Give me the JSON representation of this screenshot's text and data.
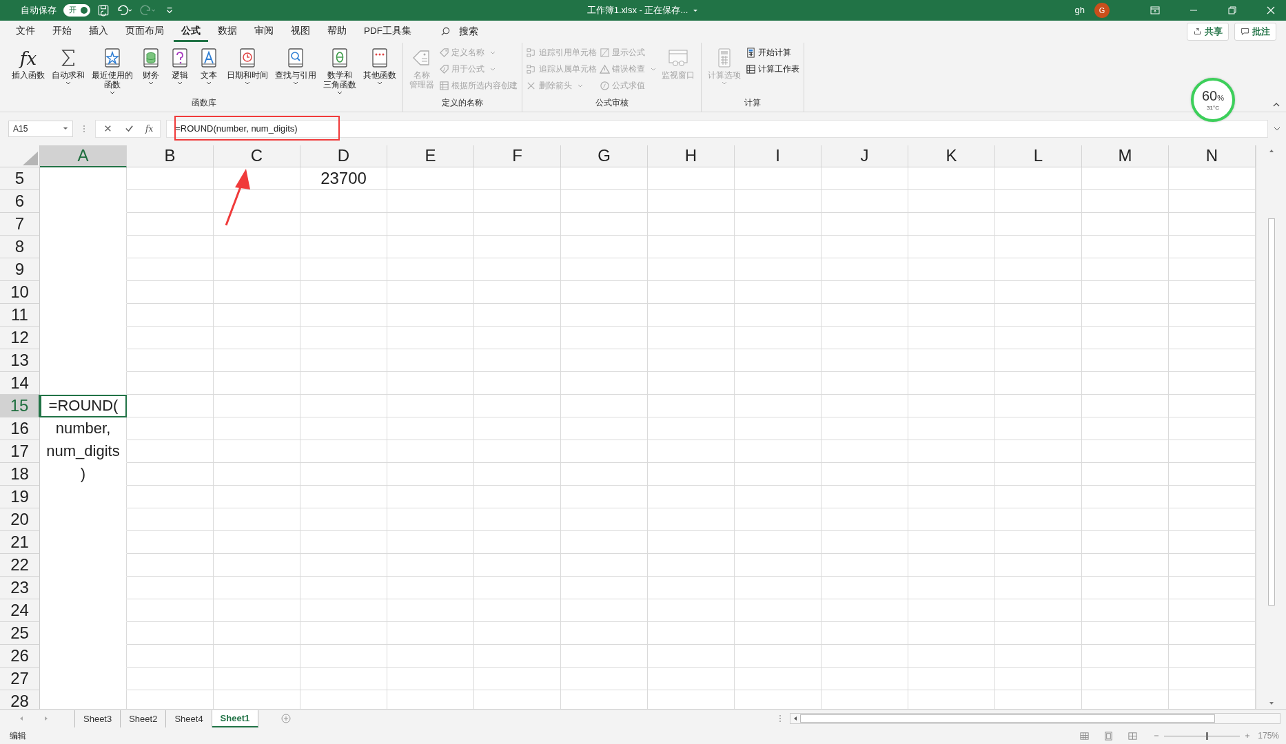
{
  "title_bar": {
    "autosave_label": "自动保存",
    "autosave_on": true,
    "autosave_state": "开",
    "title": "工作簿1.xlsx  -  正在保存...",
    "user": "gh",
    "avatar": "G"
  },
  "ribbon_tabs": [
    {
      "label": "文件",
      "selected": false
    },
    {
      "label": "开始",
      "selected": false
    },
    {
      "label": "插入",
      "selected": false
    },
    {
      "label": "页面布局",
      "selected": false
    },
    {
      "label": "公式",
      "selected": true
    },
    {
      "label": "数据",
      "selected": false
    },
    {
      "label": "审阅",
      "selected": false
    },
    {
      "label": "视图",
      "selected": false
    },
    {
      "label": "帮助",
      "selected": false
    },
    {
      "label": "PDF工具集",
      "selected": false
    }
  ],
  "search": {
    "label": "搜索"
  },
  "share_button": "共享",
  "comments_button": "批注",
  "ribbon_groups": [
    {
      "label": "函数库",
      "items": [
        {
          "kind": "large",
          "glyph": "fx",
          "label": "插入函数",
          "dropdown": false,
          "disabled": false
        },
        {
          "kind": "large",
          "label": "自动求和",
          "dropdown": true,
          "disabled": false
        },
        {
          "kind": "large",
          "label": "最近使用的函数",
          "dropdown": true,
          "disabled": false
        },
        {
          "kind": "large",
          "label": "财务",
          "dropdown": true,
          "disabled": false
        },
        {
          "kind": "large",
          "label": "逻辑",
          "dropdown": true,
          "disabled": false
        },
        {
          "kind": "large",
          "label": "文本",
          "dropdown": true,
          "disabled": false
        },
        {
          "kind": "large",
          "label": "日期和时间",
          "dropdown": true,
          "disabled": false
        },
        {
          "kind": "large",
          "label": "查找与引用",
          "dropdown": true,
          "disabled": false
        },
        {
          "kind": "large",
          "label": "数学和三角函数",
          "dropdown": true,
          "disabled": false
        },
        {
          "kind": "large",
          "label": "其他函数",
          "dropdown": true,
          "disabled": false
        }
      ]
    },
    {
      "label": "定义的名称",
      "items": [
        {
          "kind": "large",
          "label": "名称管理器",
          "dropdown": false,
          "disabled": true
        },
        {
          "kind": "stack",
          "entries": [
            {
              "label": "定义名称",
              "dropdown": true,
              "disabled": true
            },
            {
              "label": "用于公式",
              "dropdown": true,
              "disabled": true
            },
            {
              "label": "根据所选内容创建",
              "dropdown": false,
              "disabled": true
            }
          ]
        }
      ]
    },
    {
      "label": "公式审核",
      "items": [
        {
          "kind": "stack",
          "entries": [
            {
              "label": "追踪引用单元格",
              "dropdown": false,
              "disabled": true
            },
            {
              "label": "追踪从属单元格",
              "dropdown": false,
              "disabled": true
            },
            {
              "label": "删除箭头",
              "dropdown": true,
              "disabled": true
            }
          ]
        },
        {
          "kind": "stack",
          "entries": [
            {
              "label": "显示公式",
              "dropdown": false,
              "disabled": true
            },
            {
              "label": "错误检查",
              "dropdown": true,
              "disabled": true
            },
            {
              "label": "公式求值",
              "dropdown": false,
              "disabled": true
            }
          ]
        },
        {
          "kind": "large",
          "label": "监视窗口",
          "dropdown": false,
          "disabled": true
        }
      ]
    },
    {
      "label": "计算",
      "items": [
        {
          "kind": "large",
          "label": "计算选项",
          "dropdown": true,
          "disabled": true
        },
        {
          "kind": "stack",
          "entries": [
            {
              "label": "开始计算",
              "dropdown": false,
              "disabled": false
            },
            {
              "label": "计算工作表",
              "dropdown": false,
              "disabled": false
            }
          ]
        }
      ]
    }
  ],
  "status_widget": {
    "value": "60",
    "unit": "%",
    "temperature": "31°C"
  },
  "formula_bar": {
    "name_box": "A15",
    "fx": "fx",
    "formula": "=ROUND(number, num_digits)"
  },
  "columns": [
    {
      "label": "A",
      "selected": true
    },
    {
      "label": "B",
      "selected": false
    },
    {
      "label": "C",
      "selected": false
    },
    {
      "label": "D",
      "selected": false
    },
    {
      "label": "E",
      "selected": false
    },
    {
      "label": "F",
      "selected": false
    },
    {
      "label": "G",
      "selected": false
    },
    {
      "label": "H",
      "selected": false
    },
    {
      "label": "I",
      "selected": false
    },
    {
      "label": "J",
      "selected": false
    },
    {
      "label": "K",
      "selected": false
    },
    {
      "label": "L",
      "selected": false
    },
    {
      "label": "M",
      "selected": false
    },
    {
      "label": "N",
      "selected": false
    }
  ],
  "rows": [
    {
      "header": "5",
      "selected": false,
      "cells": [
        null,
        null,
        null,
        "23700"
      ]
    },
    {
      "header": "6",
      "selected": false
    },
    {
      "header": "7",
      "selected": false
    },
    {
      "header": "8",
      "selected": false
    },
    {
      "header": "9",
      "selected": false
    },
    {
      "header": "10",
      "selected": false
    },
    {
      "header": "11",
      "selected": false
    },
    {
      "header": "12",
      "selected": false
    },
    {
      "header": "13",
      "selected": false
    },
    {
      "header": "14",
      "selected": false
    },
    {
      "header": "15",
      "selected": true,
      "cells": [
        "=ROUND("
      ]
    },
    {
      "header": "16",
      "selected": false,
      "cells": [
        "number,"
      ]
    },
    {
      "header": "17",
      "selected": false,
      "cells": [
        "num_digits"
      ]
    },
    {
      "header": "18",
      "selected": false,
      "cells": [
        ")"
      ]
    },
    {
      "header": "19",
      "selected": false
    },
    {
      "header": "20",
      "selected": false
    },
    {
      "header": "21",
      "selected": false
    },
    {
      "header": "22",
      "selected": false
    },
    {
      "header": "23",
      "selected": false
    },
    {
      "header": "24",
      "selected": false
    },
    {
      "header": "25",
      "selected": false
    },
    {
      "header": "26",
      "selected": false
    },
    {
      "header": "27",
      "selected": false
    },
    {
      "header": "28",
      "selected": false
    }
  ],
  "sheet_tabs": [
    {
      "label": "Sheet3",
      "selected": false
    },
    {
      "label": "Sheet2",
      "selected": false
    },
    {
      "label": "Sheet4",
      "selected": false
    },
    {
      "label": "Sheet1",
      "selected": true
    }
  ],
  "status_bar": {
    "mode": "编辑",
    "zoom": "175%",
    "zoom_slider": {
      "level": 0.55
    }
  }
}
